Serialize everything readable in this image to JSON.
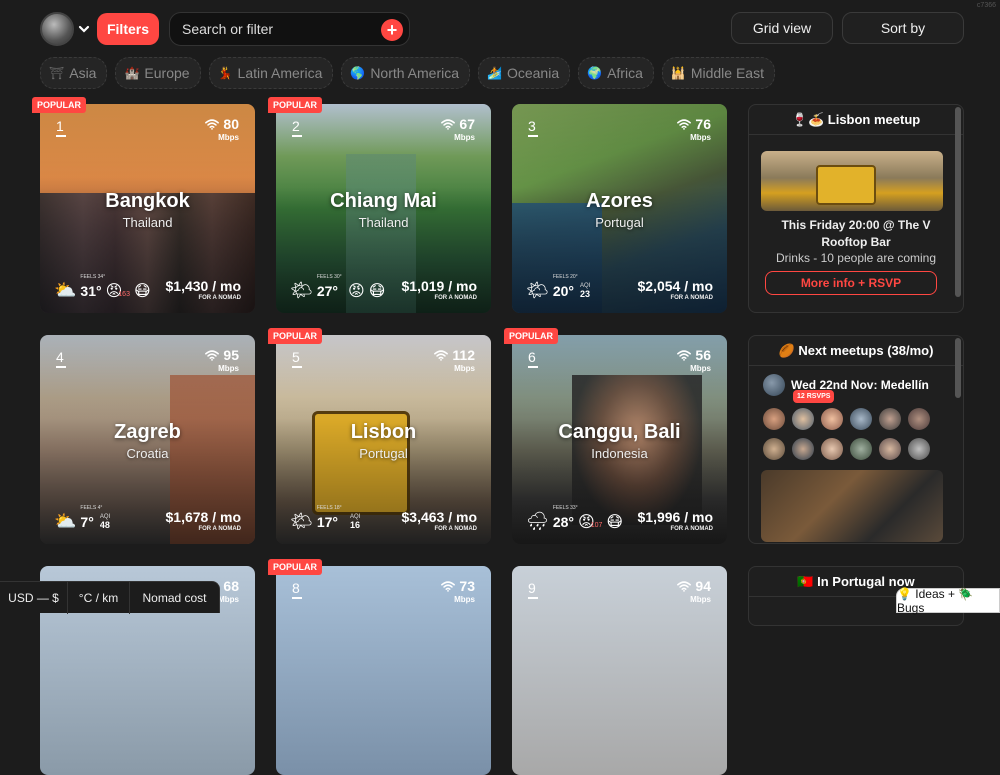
{
  "header": {
    "filters_label": "Filters",
    "search_placeholder": "Search or filter",
    "plus_label": "+",
    "grid_view_label": "Grid view",
    "sort_label": "Sort by",
    "corner_text": "c7366"
  },
  "regions": [
    {
      "icon": "⛩",
      "label": "Asia"
    },
    {
      "icon": "🏰",
      "label": "Europe"
    },
    {
      "icon": "💃",
      "label": "Latin America"
    },
    {
      "icon": "🌎",
      "label": "North America"
    },
    {
      "icon": "🏄",
      "label": "Oceania"
    },
    {
      "icon": "🌍",
      "label": "Africa"
    },
    {
      "icon": "🕌",
      "label": "Middle East"
    }
  ],
  "cards": [
    {
      "rank": "1",
      "popular": true,
      "city": "Bangkok",
      "country": "Thailand",
      "mbps": "80",
      "temp": "31°",
      "feels": "FEELS 34°",
      "aqi": "",
      "aqi_val": "163",
      "cost": "$1,430 / mo",
      "weather": "⛅",
      "faces": [
        "😡",
        "😷"
      ]
    },
    {
      "rank": "2",
      "popular": true,
      "city": "Chiang Mai",
      "country": "Thailand",
      "mbps": "67",
      "temp": "27°",
      "feels": "FEELS 30°",
      "aqi": "",
      "aqi_val": "",
      "cost": "$1,019 / mo",
      "weather": "🌤",
      "faces": [
        "😡",
        "😷"
      ]
    },
    {
      "rank": "3",
      "popular": false,
      "city": "Azores",
      "country": "Portugal",
      "mbps": "76",
      "temp": "20°",
      "feels": "FEELS 20°",
      "aqi": "AQI",
      "aqi_val": "23",
      "cost": "$2,054 / mo",
      "weather": "🌤",
      "faces": []
    },
    {
      "rank": "4",
      "popular": false,
      "city": "Zagreb",
      "country": "Croatia",
      "mbps": "95",
      "temp": "7°",
      "feels": "FEELS 4°",
      "aqi": "AQI",
      "aqi_val": "48",
      "cost": "$1,678 / mo",
      "weather": "⛅",
      "faces": []
    },
    {
      "rank": "5",
      "popular": true,
      "city": "Lisbon",
      "country": "Portugal",
      "mbps": "112",
      "temp": "17°",
      "feels": "FEELS 18°",
      "aqi": "AQI",
      "aqi_val": "16",
      "cost": "$3,463 / mo",
      "weather": "🌤",
      "faces": []
    },
    {
      "rank": "6",
      "popular": true,
      "city": "Canggu, Bali",
      "country": "Indonesia",
      "mbps": "56",
      "temp": "28°",
      "feels": "FEELS 33°",
      "aqi": "",
      "aqi_val": "107",
      "cost": "$1,996 / mo",
      "weather": "🌧",
      "faces": [
        "😡",
        "😷"
      ]
    },
    {
      "rank": "7",
      "popular": false,
      "city": "",
      "country": "",
      "mbps": "68",
      "temp": "",
      "feels": "",
      "aqi": "",
      "aqi_val": "",
      "cost": "",
      "weather": "",
      "faces": []
    },
    {
      "rank": "8",
      "popular": true,
      "city": "",
      "country": "",
      "mbps": "73",
      "temp": "",
      "feels": "",
      "aqi": "",
      "aqi_val": "",
      "cost": "",
      "weather": "",
      "faces": []
    },
    {
      "rank": "9",
      "popular": false,
      "city": "",
      "country": "",
      "mbps": "94",
      "temp": "",
      "feels": "",
      "aqi": "",
      "aqi_val": "",
      "cost": "",
      "weather": "",
      "faces": []
    }
  ],
  "labels": {
    "popular": "POPULAR",
    "mbps": "Mbps",
    "for_nomad": "FOR A NOMAD"
  },
  "meetup": {
    "title": "🍷🍝 Lisbon meetup",
    "line1": "This Friday 20:00 @ The V Rooftop Bar",
    "line2": "Drinks - 10 people are coming",
    "button": "More info + RSVP"
  },
  "next_meetups": {
    "title": "🏉 Next meetups (38/mo)",
    "date_city": "Wed 22nd Nov: Medellín",
    "rsvps": "12 RSVPS"
  },
  "now_in": {
    "title": "🇵🇹 In Portugal now"
  },
  "bottom_bar": {
    "currency": "USD — $",
    "units": "°C / km",
    "cost": "Nomad cost"
  },
  "ideas_label": "💡 Ideas + 🪲 Bugs",
  "colors": {
    "accent": "#ff4742",
    "background": "#1c1c1c"
  }
}
